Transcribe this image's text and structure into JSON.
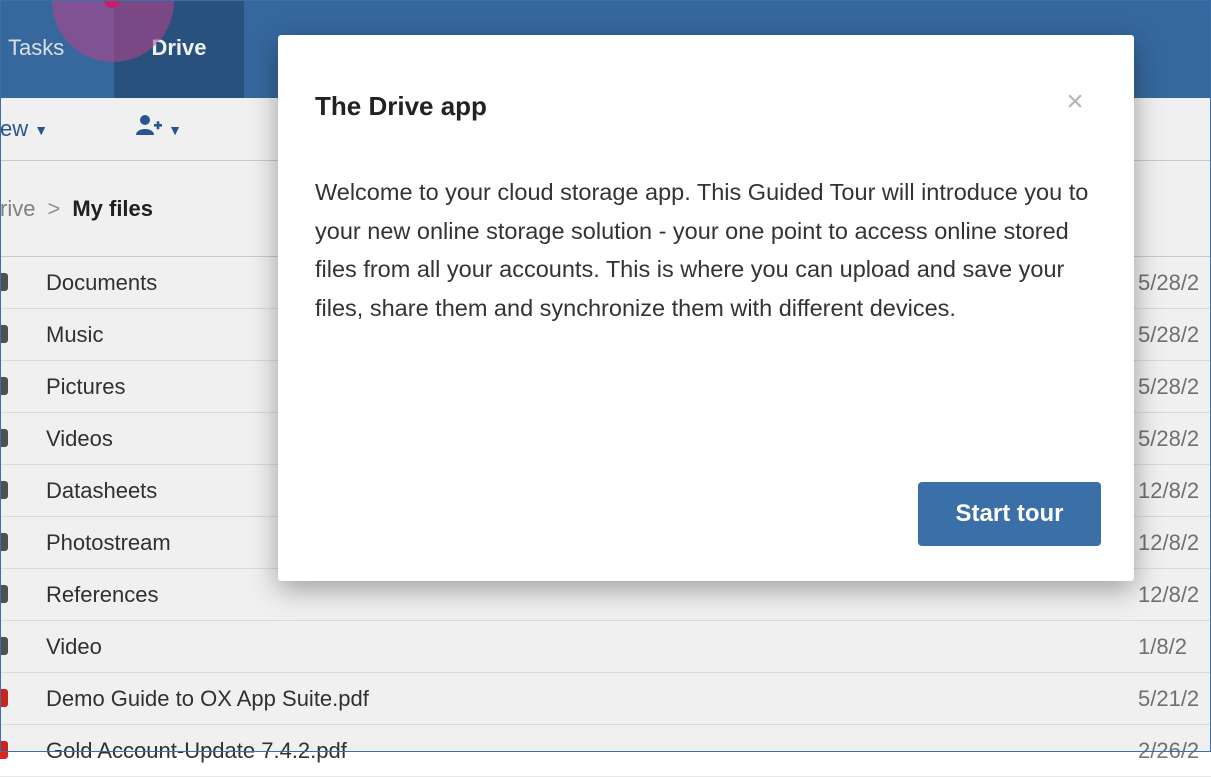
{
  "nav": {
    "tabs": [
      {
        "label": "Tasks"
      },
      {
        "label": "Drive"
      }
    ]
  },
  "toolbar": {
    "view_label": "ew",
    "share_icon": "add-user-icon"
  },
  "breadcrumb": {
    "parent": "rive",
    "separator": ">",
    "current": "My files"
  },
  "files": [
    {
      "name": "Documents",
      "date": "5/28/2"
    },
    {
      "name": "Music",
      "date": "5/28/2"
    },
    {
      "name": "Pictures",
      "date": "5/28/2"
    },
    {
      "name": "Videos",
      "date": "5/28/2"
    },
    {
      "name": "Datasheets",
      "date": "12/8/2"
    },
    {
      "name": "Photostream",
      "date": "12/8/2"
    },
    {
      "name": "References",
      "date": "12/8/2"
    },
    {
      "name": "Video",
      "date": "1/8/2"
    },
    {
      "name": "Demo Guide to OX App Suite.pdf",
      "date": "5/21/2"
    },
    {
      "name": "Gold Account-Update 7.4.2.pdf",
      "date": "2/26/2"
    }
  ],
  "modal": {
    "title": "The Drive app",
    "close_symbol": "×",
    "body": "Welcome to your cloud storage app. This Guided Tour will introduce you to your new online storage solution - your one point to access online stored files from all your accounts. This is where you can upload and save your files, share them and synchronize them with different devices.",
    "button_label": "Start tour"
  },
  "colors": {
    "brand_blue": "#3a6fa8",
    "active_tab": "#2c5786",
    "tour_highlight": "#d81f6f",
    "pdf_red": "#d9261c"
  }
}
